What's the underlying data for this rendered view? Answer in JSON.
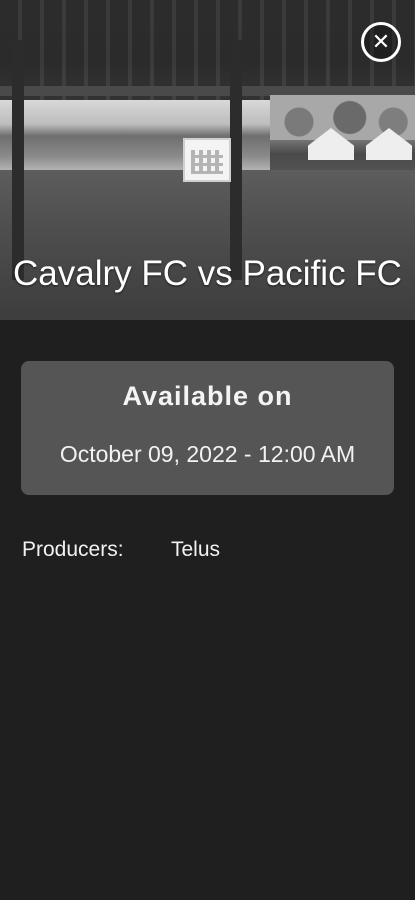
{
  "event": {
    "title": "Cavalry FC vs Pacific FC"
  },
  "availability": {
    "heading": "Available on",
    "datetime": "October 09, 2022 - 12:00 AM"
  },
  "producers": {
    "label": "Producers:",
    "value": "Telus"
  },
  "icons": {
    "close": "close-icon"
  },
  "colors": {
    "background": "#1f1f1f",
    "card": "#555555",
    "text": "#f2f2f2"
  }
}
